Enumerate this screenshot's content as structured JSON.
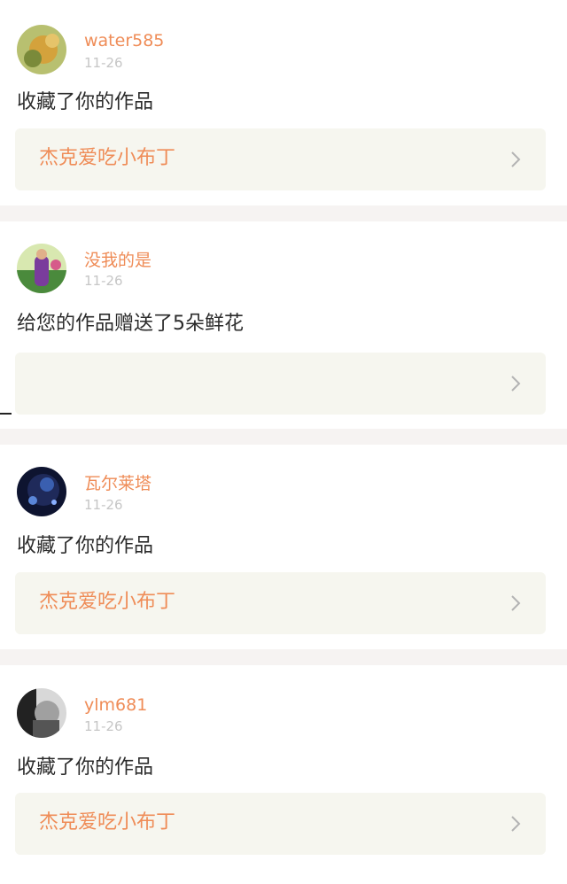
{
  "notifications": [
    {
      "username": "water585",
      "time": "11-26",
      "action": "收藏了你的作品",
      "work_title": "杰克爱吃小布丁",
      "avatar_colors": [
        "#b8c070",
        "#d4a23c",
        "#7a8a3a"
      ]
    },
    {
      "username": "没我的是",
      "time": "11-26",
      "action": "给您的作品赠送了5朵鲜花",
      "work_title": "",
      "avatar_colors": [
        "#d8e8b0",
        "#7a3c9c",
        "#4a8a3c"
      ]
    },
    {
      "username": "瓦尔莱塔",
      "time": "11-26",
      "action": "收藏了你的作品",
      "work_title": "杰克爱吃小布丁",
      "avatar_colors": [
        "#1f2a5a",
        "#3a5fb0",
        "#0e1430"
      ]
    },
    {
      "username": "ylm681",
      "time": "11-26",
      "action": "收藏了你的作品",
      "work_title": "杰克爱吃小布丁",
      "avatar_colors": [
        "#d8d8d8",
        "#555555",
        "#222222"
      ]
    }
  ],
  "colors": {
    "accent": "#ef8c57",
    "card_bg": "#f6f6ef",
    "separator": "#f6f3f2",
    "time": "#c6c6c6",
    "text": "#2b2b2b"
  }
}
